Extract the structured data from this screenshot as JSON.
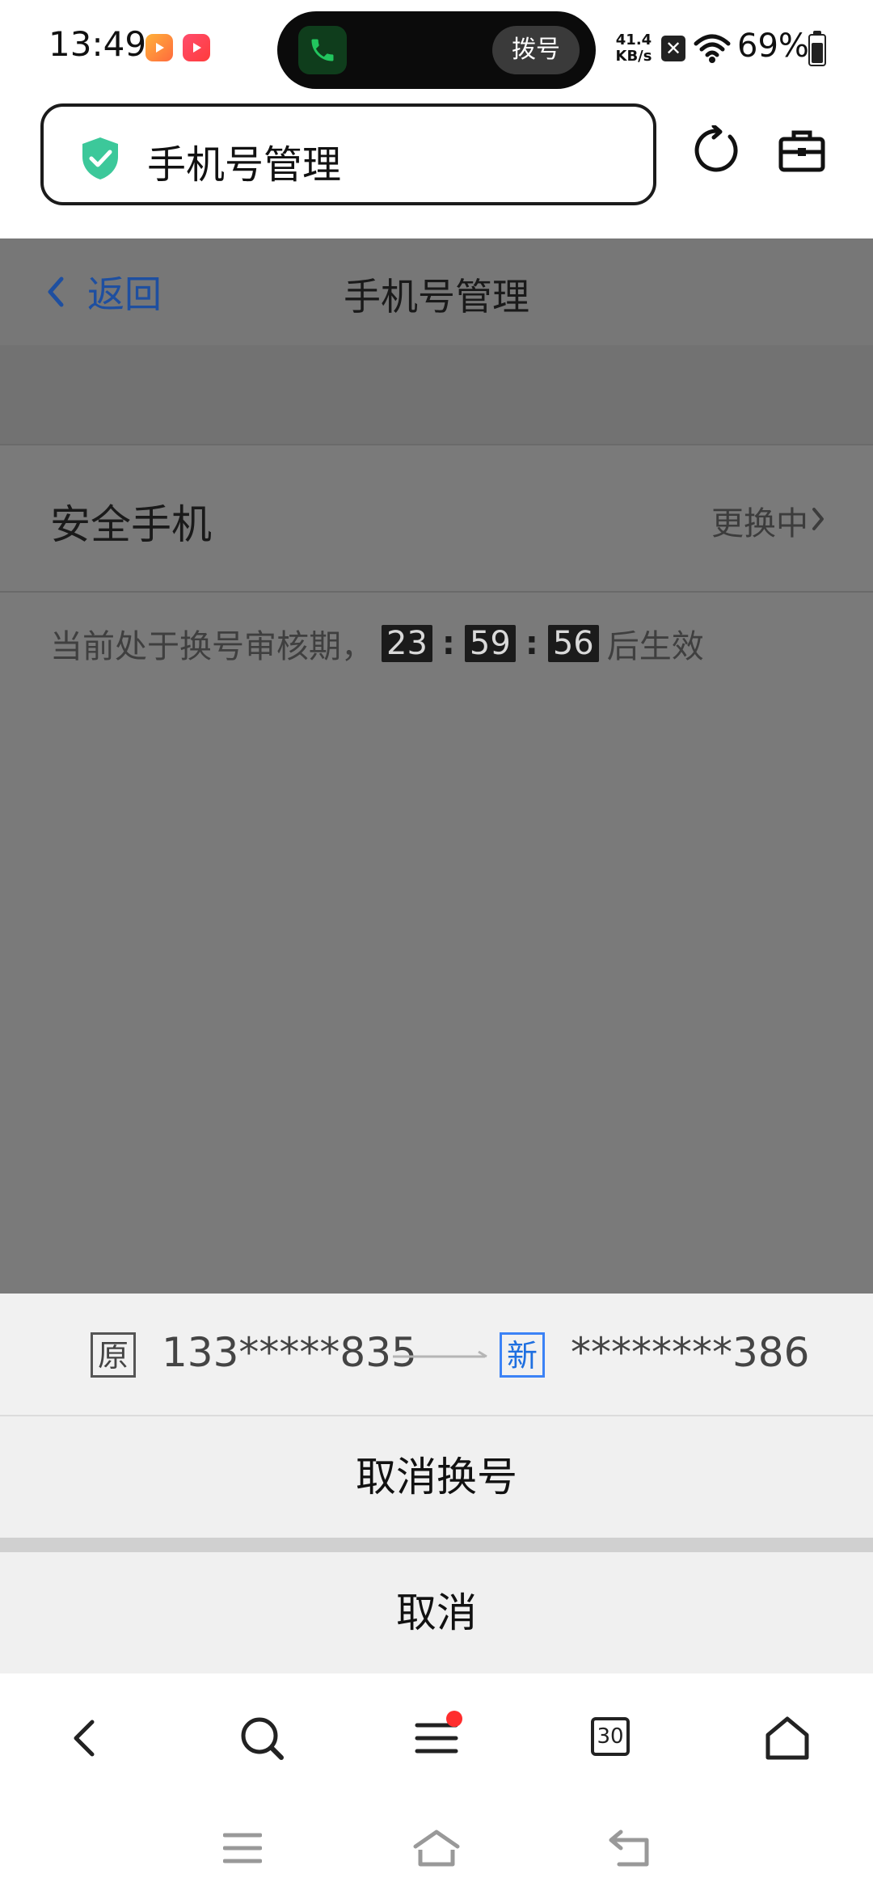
{
  "status_bar": {
    "time": "13:49",
    "network_speed_value": "41.4",
    "network_speed_unit": "KB/s",
    "battery_percent": "69%",
    "battery_level": 0.69,
    "call_pill_button": "拨号",
    "icons": [
      "app-icon-1",
      "app-icon-2",
      "phone-icon",
      "sim-x-icon",
      "wifi-icon",
      "battery-icon"
    ]
  },
  "browser": {
    "url_title": "手机号管理",
    "icons": [
      "shield-check-icon",
      "reload-icon",
      "toolbox-icon"
    ]
  },
  "page": {
    "back_label": "返回",
    "title": "手机号管理",
    "row_label": "安全手机",
    "row_status": "更换中",
    "notice_prefix": "当前处于换号审核期，",
    "timer": {
      "hours": "23",
      "minutes": "59",
      "seconds": "56"
    },
    "notice_suffix": "后生效"
  },
  "sheet": {
    "old_tag": "原",
    "old_number": "133*****835",
    "new_tag": "新",
    "new_number": "********386",
    "cancel_change_label": "取消换号",
    "cancel_label": "取消"
  },
  "bottom_nav": {
    "tabs_count": "30",
    "icons": [
      "back-icon",
      "search-icon",
      "menu-icon",
      "tabs-icon",
      "home-icon"
    ]
  },
  "system_nav": {
    "icons": [
      "recents-icon",
      "home-icon",
      "back-icon"
    ]
  }
}
